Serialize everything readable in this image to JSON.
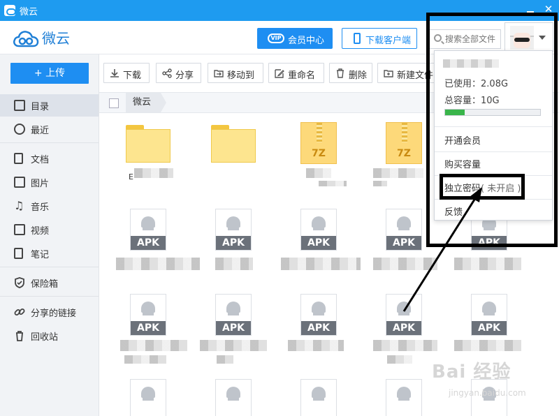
{
  "window": {
    "title": "微云"
  },
  "header": {
    "brand": "微云",
    "vip_button": "会员中心",
    "vip_badge": "VIP",
    "download_client_button": "下载客户端",
    "search_placeholder": "搜索全部文件"
  },
  "sidebar": {
    "upload_button": "+ 上传",
    "items": [
      {
        "label": "目录",
        "icon": "list-icon",
        "active": true
      },
      {
        "label": "最近",
        "icon": "clock-icon"
      },
      {
        "label": "文档",
        "icon": "document-icon"
      },
      {
        "label": "图片",
        "icon": "image-icon"
      },
      {
        "label": "音乐",
        "icon": "music-icon"
      },
      {
        "label": "视频",
        "icon": "video-icon"
      },
      {
        "label": "笔记",
        "icon": "note-icon"
      },
      {
        "label": "保险箱",
        "icon": "shield-icon"
      },
      {
        "label": "分享的链接",
        "icon": "link-icon"
      },
      {
        "label": "回收站",
        "icon": "trash-icon"
      }
    ]
  },
  "toolbar": {
    "download": "下载",
    "share": "分享",
    "move_to": "移动到",
    "rename": "重命名",
    "delete": "删除",
    "new_folder": "新建文件"
  },
  "breadcrumb": {
    "current": "微云"
  },
  "files": {
    "folder_name_prefix": "E",
    "zip_label": "7Z",
    "apk_label": "APK"
  },
  "account_menu": {
    "used_label": "已使用：",
    "used_value": "2.08G",
    "total_label": "总容量：",
    "total_value": "10G",
    "usage_fraction": 0.208,
    "items": {
      "open_vip": "开通会员",
      "buy_storage": "购买容量",
      "independent_password": "独立密码",
      "independent_password_status": "( 未开启 )",
      "feedback": "反馈"
    }
  },
  "watermark": {
    "line1": "Bai 经验",
    "line2": "jingyan.baidu.com"
  },
  "colors": {
    "accent": "#1e8ef2",
    "titlebar": "#1e9bf0",
    "progress": "#39b54a"
  }
}
